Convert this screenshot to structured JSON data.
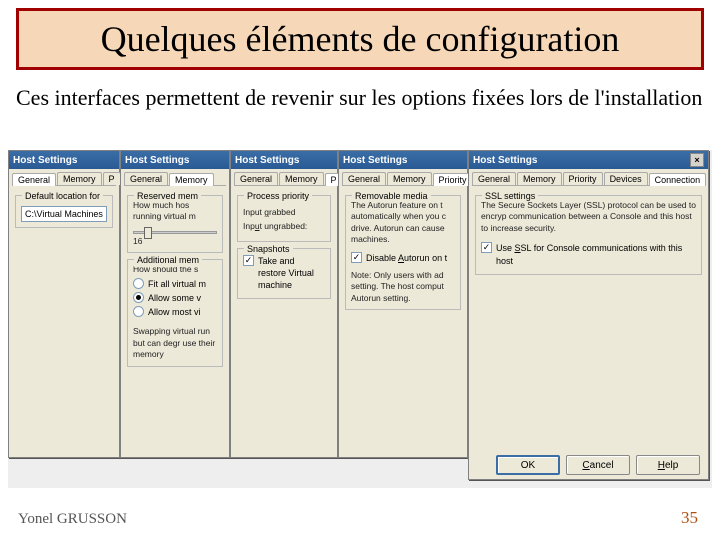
{
  "slide": {
    "title": "Quelques éléments de configuration",
    "subtitle": "Ces interfaces permettent de revenir sur les options fixées lors de l'installation",
    "author": "Yonel GRUSSON",
    "page": "35"
  },
  "common": {
    "window_title": "Host Settings",
    "close_glyph": "×",
    "tabs": {
      "general": "General",
      "memory": "Memory",
      "priority": "Priority",
      "devices": "Devices",
      "connection": "Connection",
      "p_short": "P"
    }
  },
  "buttons": {
    "ok": "OK",
    "cancel": "Cancel",
    "help": "Help"
  },
  "win1": {
    "group1_legend": "Default location for",
    "path": "C:\\Virtual Machines"
  },
  "win2": {
    "g1_legend": "Reserved mem",
    "g1_text": "How much hos running virtual m",
    "slider_value": "16",
    "g2_legend": "Additional mem",
    "g2_text": "How should the s",
    "r1": "Fit all virtual m",
    "r2": "Allow some v",
    "r3": "Allow most vi",
    "note": "Swapping virtual run but can degr use their memory"
  },
  "win3": {
    "g1_legend": "Process priority",
    "row1": "Input grabbed",
    "row2": "Input ungrabbed:",
    "g2_legend": "Snapshots",
    "chk": "Take and restore Virtual machine"
  },
  "win4": {
    "g1_legend": "Removable media",
    "g1_text": "The Autorun feature on t automatically when you c drive. Autorun can cause machines.",
    "chk": "Disable Autorun on t",
    "note": "Note: Only users with ad setting. The host comput Autorun setting."
  },
  "win5": {
    "g1_legend": "SSL settings",
    "g1_text": "The Secure Sockets Layer (SSL) protocol can be used to encryp communication between a Console and this host to increase security.",
    "chk": "Use SSL for Console communications with this host"
  }
}
